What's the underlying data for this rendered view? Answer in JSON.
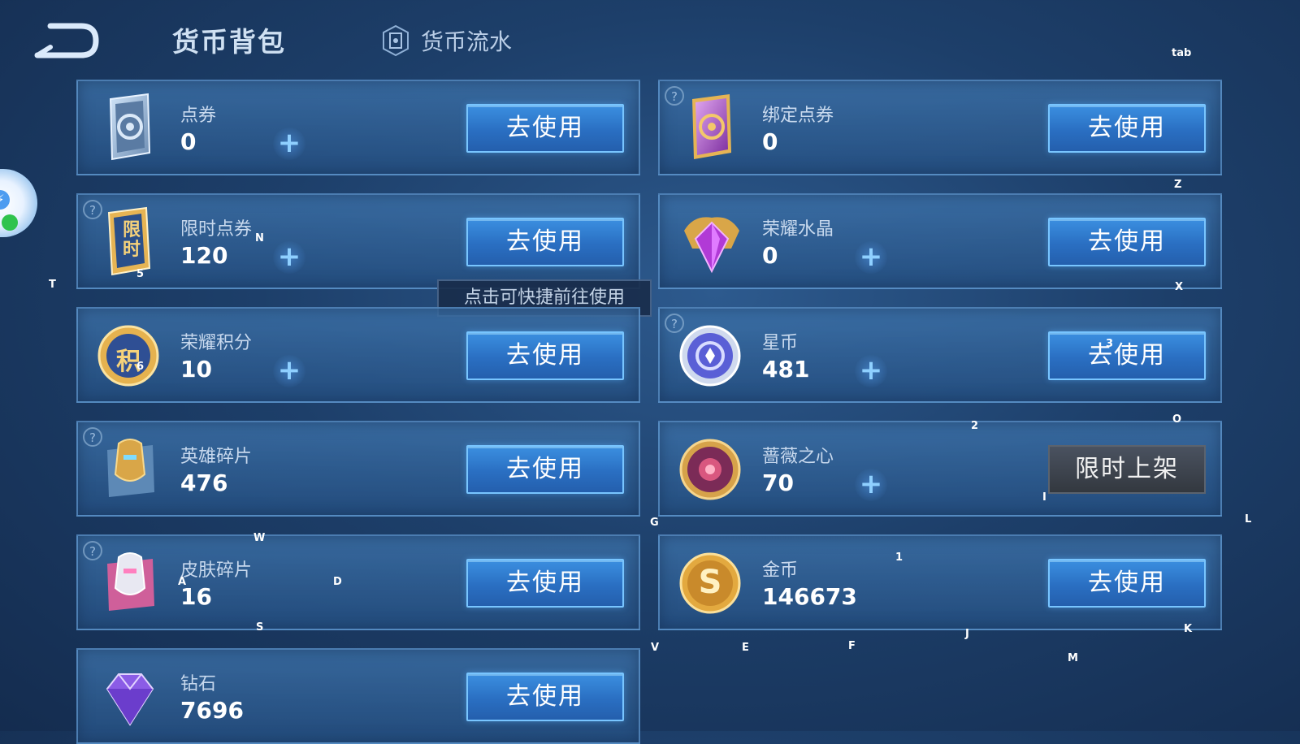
{
  "header": {
    "wallet_tab": "货币背包",
    "flow_tab": "货币流水",
    "tab_hint": "tab"
  },
  "tooltip": "点击可快捷前往使用",
  "currencies": [
    {
      "name": "点券",
      "value": "0",
      "button": "去使用",
      "icon": "coupon-card-icon"
    },
    {
      "name": "绑定点券",
      "value": "0",
      "button": "去使用",
      "icon": "bound-coupon-card-icon"
    },
    {
      "name": "限时点券",
      "value": "120",
      "button": "去使用",
      "icon": "limited-coupon-icon",
      "icon_text": "限时"
    },
    {
      "name": "荣耀水晶",
      "value": "0",
      "button": "去使用",
      "icon": "glory-crystal-icon"
    },
    {
      "name": "荣耀积分",
      "value": "10",
      "button": "去使用",
      "icon": "glory-points-icon",
      "icon_text": "积"
    },
    {
      "name": "星币",
      "value": "481",
      "button": "去使用",
      "icon": "star-coin-icon"
    },
    {
      "name": "英雄碎片",
      "value": "476",
      "button": "去使用",
      "icon": "hero-fragment-icon"
    },
    {
      "name": "蔷薇之心",
      "value": "70",
      "button": "限时上架",
      "icon": "rose-heart-icon"
    },
    {
      "name": "皮肤碎片",
      "value": "16",
      "button": "去使用",
      "icon": "skin-fragment-icon"
    },
    {
      "name": "金币",
      "value": "146673",
      "button": "去使用",
      "icon": "gold-coin-icon",
      "icon_text": "S"
    },
    {
      "name": "钻石",
      "value": "7696",
      "button": "去使用",
      "icon": "diamond-icon"
    }
  ],
  "keyboard_hints": [
    "T",
    "N",
    "5",
    "6",
    "W",
    "A",
    "D",
    "S",
    "Z",
    "X",
    "3",
    "2",
    "O",
    "G",
    "I",
    "L",
    "1",
    "V",
    "E",
    "F",
    "J",
    "K",
    "M"
  ],
  "colors": {
    "accent_button": "#2a6fc2",
    "button_border": "#78c5ff",
    "plus": "#8fd0ff",
    "background": "#1d3f6a"
  }
}
